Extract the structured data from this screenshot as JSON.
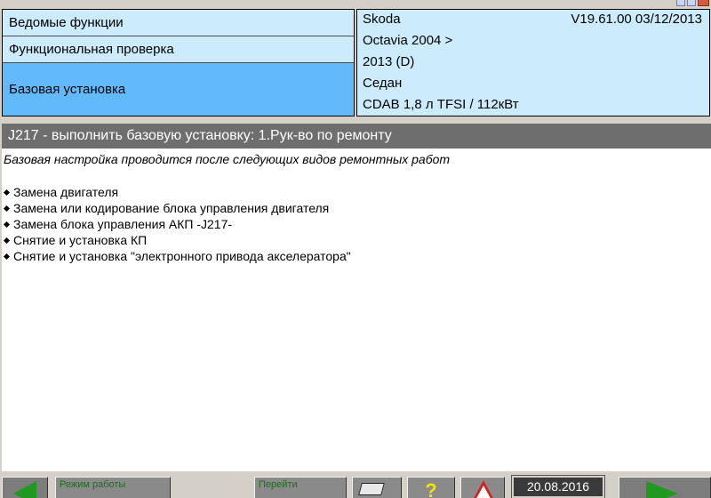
{
  "header": {
    "menu": [
      {
        "label": "Ведомые функции"
      },
      {
        "label": "Функциональная проверка"
      },
      {
        "label": "Базовая установка"
      }
    ],
    "vehicle": {
      "brand": "Skoda",
      "version": "V19.61.00 03/12/2013",
      "model": "Octavia 2004 >",
      "year": "2013 (D)",
      "body": "Седан",
      "engine": "CDAB 1,8 л TFSI / 112кВт"
    }
  },
  "section": {
    "title": "J217 - выполнить базовую установку: 1.Рук-во по ремонту"
  },
  "content": {
    "intro": "Базовая настройка проводится после следующих видов ремонтных работ",
    "items": [
      "Замена двигателя",
      "Замена или кодирование блока управления двигателя",
      "Замена блока управления АКП -J217-",
      "Снятие и установка КП",
      "Снятие и установка  \"электронного привода акселератора\""
    ]
  },
  "toolbar": {
    "mode_label": "Режим работы",
    "goto_label": "Перейти",
    "help_symbol": "?",
    "date": "20.08.2016"
  },
  "colors": {
    "menu_bg": "#ccecfd",
    "menu_active_bg": "#62bafc",
    "section_bg": "#6e6e6e",
    "nav_arrow": "#1f9a1f"
  }
}
